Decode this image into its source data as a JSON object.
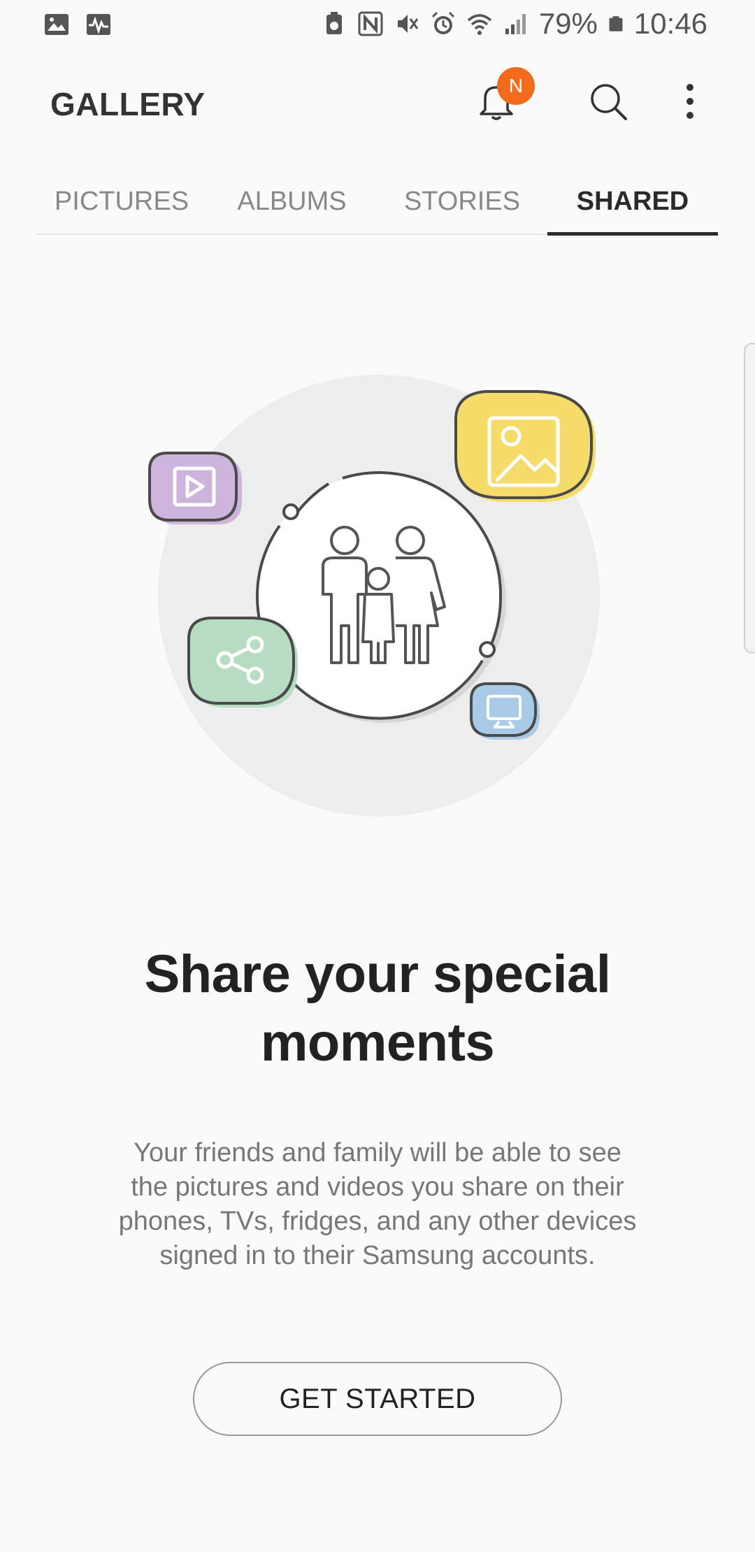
{
  "status_bar": {
    "battery": "79%",
    "time": "10:46",
    "left_icons": [
      "image-icon",
      "activity-icon"
    ],
    "right_icons": [
      "battery-saver-icon",
      "nfc-icon",
      "vibrate-icon",
      "alarm-icon",
      "wifi-icon",
      "signal-icon",
      "battery-icon"
    ]
  },
  "header": {
    "title": "GALLERY",
    "notification_badge": "N",
    "badge_color": "#f26b1d"
  },
  "tabs": [
    {
      "label": "PICTURES",
      "active": false
    },
    {
      "label": "ALBUMS",
      "active": false
    },
    {
      "label": "STORIES",
      "active": false
    },
    {
      "label": "SHARED",
      "active": true
    }
  ],
  "illustration": {
    "icons": [
      "family-icon",
      "video-icon",
      "picture-icon",
      "share-icon",
      "tv-icon"
    ],
    "colors": {
      "video": "#cdb4dc",
      "picture": "#f5dc6a",
      "share": "#b6ddc1",
      "tv": "#a9cbe8",
      "backdrop": "#ededed"
    }
  },
  "main": {
    "headline_line1": "Share your special",
    "headline_line2": "moments",
    "description_lines": [
      "Your friends and family will be able to see",
      "the pictures and videos you share on their",
      "phones, TVs, fridges, and any other devices",
      "signed in to their Samsung accounts."
    ],
    "button_label": "GET STARTED"
  }
}
